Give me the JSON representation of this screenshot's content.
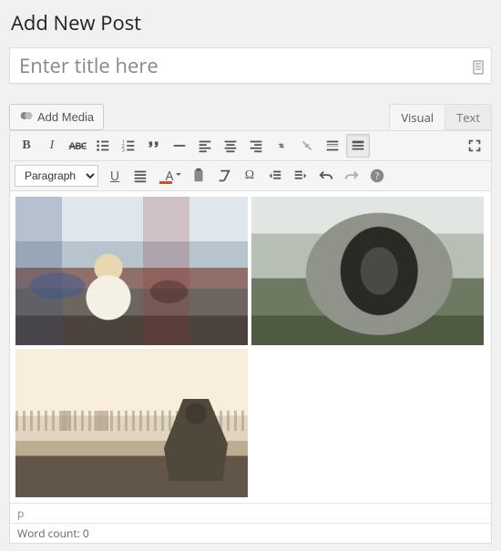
{
  "page": {
    "title": "Add New Post"
  },
  "title_field": {
    "value": "",
    "placeholder": "Enter title here"
  },
  "media_button": {
    "label": "Add Media"
  },
  "tabs": {
    "visual": "Visual",
    "text": "Text",
    "active": "visual"
  },
  "format_dropdown": {
    "selected": "Paragraph"
  },
  "status": {
    "path": "p",
    "word_count": "Word count: 0"
  },
  "gallery": {
    "count": 3
  },
  "icons": {
    "bold": "B",
    "italic": "I",
    "strike": "ABC",
    "underline": "U",
    "font_color": "A"
  }
}
